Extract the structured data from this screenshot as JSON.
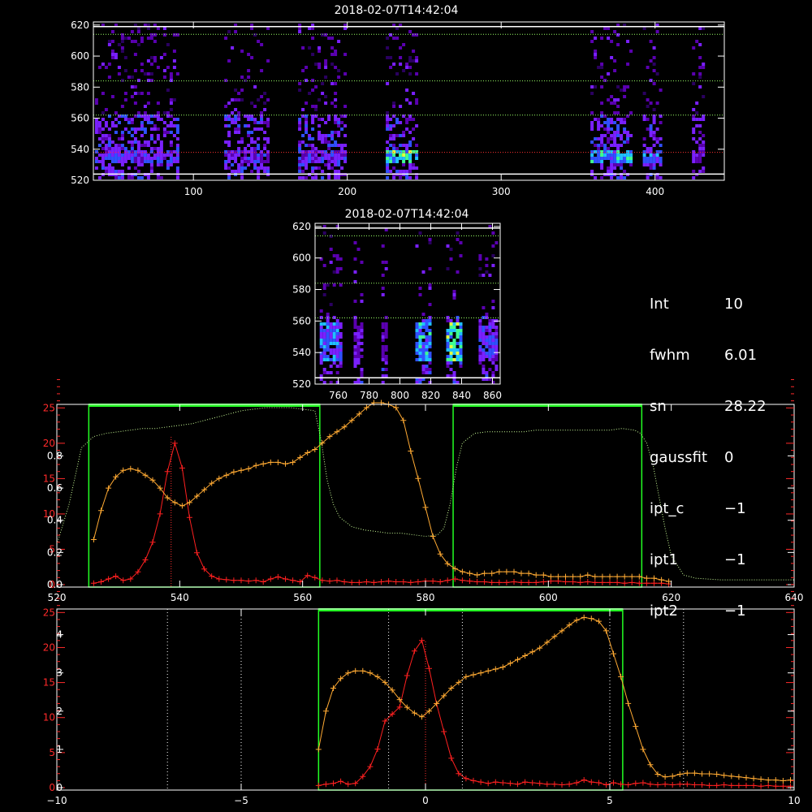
{
  "info_panel": [
    {
      "key": "Int",
      "value": "10"
    },
    {
      "key": "fwhm",
      "value": "6.01"
    },
    {
      "key": "sn",
      "value": "28.22"
    },
    {
      "key": "gaussfit",
      "value": "0"
    },
    {
      "key": "ipt_c",
      "value": "−1"
    },
    {
      "key": "ipt1",
      "value": "−1"
    },
    {
      "key": "ipt2",
      "value": "−1"
    }
  ],
  "chart_data": [
    {
      "type": "heatmap",
      "title": "2018-02-07T14:42:04",
      "xlim": [
        35,
        445
      ],
      "ylim": [
        520,
        622
      ],
      "xticks": [
        100,
        200,
        300,
        400
      ],
      "yticks": [
        520,
        540,
        560,
        580,
        600,
        620
      ],
      "colormap": [
        "#000000",
        "#2a0060",
        "#5a00b0",
        "#7a20ff",
        "#3050ff",
        "#20c0ff",
        "#40ff90",
        "#e0ff40"
      ],
      "hlines": {
        "solid_white": [
          524,
          619
        ],
        "dotted_green": [
          562,
          584,
          614
        ],
        "dotted_red": [
          538
        ]
      },
      "bands": [
        {
          "x": [
            36,
            90
          ],
          "core_intensity": 0.6
        },
        {
          "x": [
            120,
            148
          ],
          "core_intensity": 0.55
        },
        {
          "x": [
            168,
            198
          ],
          "core_intensity": 0.55
        },
        {
          "x": [
            225,
            245
          ],
          "core_intensity": 0.95
        },
        {
          "x": [
            358,
            385
          ],
          "core_intensity": 0.85
        },
        {
          "x": [
            392,
            404
          ],
          "core_intensity": 0.75
        },
        {
          "x": [
            424,
            432
          ],
          "core_intensity": 0.45
        }
      ]
    },
    {
      "type": "heatmap",
      "title": "2018-02-07T14:42:04",
      "xlim": [
        745,
        865
      ],
      "ylim": [
        520,
        622
      ],
      "xticks": [
        760,
        780,
        800,
        820,
        840,
        860
      ],
      "yticks": [
        520,
        540,
        560,
        580,
        600,
        620
      ],
      "hlines": {
        "solid_white": [
          619,
          524
        ],
        "dotted_green": [
          562,
          584,
          614
        ]
      },
      "bands": [
        {
          "x": [
            748,
            762
          ],
          "core_intensity": 0.7
        },
        {
          "x": [
            770,
            776
          ],
          "core_intensity": 0.45
        },
        {
          "x": [
            788,
            792
          ],
          "core_intensity": 0.4
        },
        {
          "x": [
            810,
            820
          ],
          "core_intensity": 0.85
        },
        {
          "x": [
            830,
            840
          ],
          "core_intensity": 1.0
        },
        {
          "x": [
            851,
            862
          ],
          "core_intensity": 0.6
        }
      ]
    },
    {
      "type": "line",
      "xlim": [
        520,
        640
      ],
      "ylim_left": [
        0,
        25.5
      ],
      "xticks": [
        520,
        540,
        560,
        580,
        600,
        620,
        640
      ],
      "yticks_red": [
        0,
        5,
        10,
        15,
        20,
        25
      ],
      "yticks_white": [
        "0.0",
        "0.2",
        "0.4",
        "0.6",
        "0.8"
      ],
      "yticks_white_values": [
        0.0,
        0.2,
        0.4,
        0.6,
        0.8
      ],
      "white_axis_max": 1.12,
      "green_boxes": [
        [
          525.2,
          562.8
        ],
        [
          584.5,
          615.2
        ]
      ],
      "red_dotted_vline": 538.6,
      "series": [
        {
          "color": "#ff2020",
          "x": [
            526,
            527.2,
            528.4,
            529.6,
            530.8,
            532,
            533.2,
            534.4,
            535.6,
            536.8,
            538,
            539.2,
            540.4,
            541.6,
            542.8,
            544,
            545.2,
            546.4,
            547.6,
            548.8,
            550,
            551.2,
            552.4,
            553.6,
            554.8,
            556,
            557.2,
            558.4,
            559.6,
            560.8,
            562,
            563.2,
            564.4,
            565.6,
            566.8,
            568,
            569.2,
            570.4,
            571.6,
            572.8,
            574,
            575.2,
            576.4,
            577.6,
            578.8,
            580,
            581.2,
            582.4,
            583.6,
            584.8,
            586,
            587.2,
            588.4,
            589.6,
            590.8,
            592,
            593.2,
            594.4,
            595.6,
            596.8,
            598,
            599.2,
            600.4,
            601.6,
            602.8,
            604,
            605.2,
            606.4,
            607.6,
            608.8,
            610,
            611.2,
            612.4,
            613.6,
            614.8,
            616,
            617.2,
            618.4,
            619.6
          ],
          "y": [
            0.2,
            0.4,
            0.8,
            1.2,
            0.6,
            0.8,
            1.8,
            3.5,
            6.0,
            10.0,
            16.0,
            20.0,
            16.5,
            9.5,
            4.5,
            2.2,
            1.2,
            0.8,
            0.7,
            0.6,
            0.6,
            0.5,
            0.6,
            0.4,
            0.8,
            1.1,
            0.8,
            0.6,
            0.4,
            1.3,
            1.0,
            0.6,
            0.5,
            0.6,
            0.4,
            0.3,
            0.3,
            0.4,
            0.3,
            0.4,
            0.5,
            0.4,
            0.4,
            0.3,
            0.4,
            0.5,
            0.5,
            0.4,
            0.6,
            0.8,
            0.6,
            0.5,
            0.4,
            0.4,
            0.3,
            0.3,
            0.3,
            0.4,
            0.3,
            0.3,
            0.3,
            0.4,
            0.5,
            0.5,
            0.4,
            0.4,
            0.3,
            0.4,
            0.3,
            0.3,
            0.3,
            0.3,
            0.2,
            0.3,
            0.2,
            0.2,
            0.2,
            0.2,
            0.1
          ]
        },
        {
          "color": "#ffaa33",
          "x": [
            526,
            527.2,
            528.4,
            529.6,
            530.8,
            532,
            533.2,
            534.4,
            535.6,
            536.8,
            538,
            539.2,
            540.4,
            541.6,
            542.8,
            544,
            545.2,
            546.4,
            547.6,
            548.8,
            550,
            551.2,
            552.4,
            553.6,
            554.8,
            556,
            557.2,
            558.4,
            559.6,
            560.8,
            562,
            563.2,
            564.4,
            565.6,
            566.8,
            568,
            569.2,
            570.4,
            571.6,
            572.8,
            574,
            575.2,
            576.4,
            577.6,
            578.8,
            580,
            581.2,
            582.4,
            583.6,
            584.8,
            586,
            587.2,
            588.4,
            589.6,
            590.8,
            592,
            593.2,
            594.4,
            595.6,
            596.8,
            598,
            599.2,
            600.4,
            601.6,
            602.8,
            604,
            605.2,
            606.4,
            607.6,
            608.8,
            610,
            611.2,
            612.4,
            613.6,
            614.8,
            616,
            617.2,
            618.4,
            619.6
          ],
          "y": [
            0.28,
            0.46,
            0.6,
            0.67,
            0.71,
            0.72,
            0.71,
            0.68,
            0.65,
            0.6,
            0.54,
            0.51,
            0.49,
            0.51,
            0.55,
            0.59,
            0.63,
            0.66,
            0.68,
            0.7,
            0.71,
            0.72,
            0.74,
            0.75,
            0.76,
            0.76,
            0.75,
            0.76,
            0.79,
            0.82,
            0.84,
            0.88,
            0.92,
            0.95,
            0.98,
            1.02,
            1.06,
            1.1,
            1.13,
            1.13,
            1.12,
            1.1,
            1.02,
            0.83,
            0.66,
            0.48,
            0.3,
            0.19,
            0.13,
            0.1,
            0.08,
            0.07,
            0.06,
            0.07,
            0.07,
            0.08,
            0.08,
            0.08,
            0.07,
            0.07,
            0.06,
            0.06,
            0.05,
            0.05,
            0.05,
            0.05,
            0.05,
            0.06,
            0.05,
            0.05,
            0.05,
            0.05,
            0.05,
            0.05,
            0.05,
            0.04,
            0.04,
            0.03,
            0.02
          ],
          "white_scale": true
        },
        {
          "color": "#ccff99",
          "dotted": true,
          "white_scale": true,
          "x": [
            520,
            522,
            524,
            526,
            528,
            530,
            532,
            534,
            536,
            538,
            540,
            542,
            544,
            546,
            548,
            550,
            552,
            554,
            556,
            558,
            560,
            562,
            563,
            564,
            565,
            566,
            568,
            570,
            572,
            574,
            576,
            578,
            580,
            582,
            583,
            584,
            585,
            586,
            588,
            590,
            592,
            594,
            596,
            598,
            600,
            602,
            604,
            606,
            608,
            610,
            612,
            614,
            615,
            616,
            617,
            618,
            619,
            620,
            622,
            624,
            628,
            632,
            636,
            640
          ],
          "y": [
            0.25,
            0.5,
            0.85,
            0.92,
            0.94,
            0.95,
            0.96,
            0.97,
            0.97,
            0.98,
            0.99,
            1.0,
            1.02,
            1.04,
            1.06,
            1.08,
            1.09,
            1.1,
            1.1,
            1.1,
            1.09,
            1.08,
            0.9,
            0.65,
            0.5,
            0.42,
            0.36,
            0.34,
            0.33,
            0.32,
            0.32,
            0.31,
            0.3,
            0.31,
            0.35,
            0.5,
            0.72,
            0.88,
            0.94,
            0.95,
            0.95,
            0.95,
            0.95,
            0.96,
            0.96,
            0.96,
            0.96,
            0.96,
            0.96,
            0.96,
            0.97,
            0.96,
            0.94,
            0.88,
            0.75,
            0.55,
            0.35,
            0.18,
            0.06,
            0.04,
            0.03,
            0.03,
            0.03,
            0.03
          ]
        }
      ]
    },
    {
      "type": "line",
      "xlim": [
        -10,
        10
      ],
      "ylim_left": [
        0,
        25.5
      ],
      "xticks": [
        -10,
        -5,
        0,
        5,
        10
      ],
      "yticks_red": [
        0,
        5,
        10,
        15,
        20,
        25
      ],
      "yticks_white": [
        "0",
        "1",
        "2",
        "3",
        "4"
      ],
      "yticks_white_values": [
        0,
        1,
        2,
        3,
        4
      ],
      "white_axis_max": 4.67,
      "green_box": [
        -2.9,
        5.35
      ],
      "dotted_vlines": [
        -7,
        -5,
        -1,
        1,
        5,
        7
      ],
      "red_dotted_vline": 0,
      "series": [
        {
          "color": "#ff2020",
          "x": [
            -2.9,
            -2.7,
            -2.5,
            -2.3,
            -2.1,
            -1.9,
            -1.7,
            -1.5,
            -1.3,
            -1.1,
            -0.9,
            -0.7,
            -0.5,
            -0.3,
            -0.1,
            0.1,
            0.3,
            0.5,
            0.7,
            0.9,
            1.1,
            1.3,
            1.5,
            1.7,
            1.9,
            2.1,
            2.3,
            2.5,
            2.7,
            2.9,
            3.1,
            3.3,
            3.5,
            3.7,
            3.9,
            4.1,
            4.3,
            4.5,
            4.7,
            4.9,
            5.1,
            5.3,
            5.5,
            5.7,
            5.9,
            6.1,
            6.3,
            6.5,
            6.7,
            6.9,
            7.1,
            7.3,
            7.5,
            7.7,
            7.9,
            8.1,
            8.3,
            8.5,
            8.7,
            8.9,
            9.1,
            9.3,
            9.5,
            9.7,
            9.9
          ],
          "y": [
            0.3,
            0.5,
            0.6,
            0.9,
            0.5,
            0.6,
            1.6,
            3.0,
            5.5,
            9.5,
            10.5,
            11.5,
            16.0,
            19.5,
            21.0,
            17.0,
            12.0,
            8.0,
            4.2,
            2.0,
            1.3,
            1.0,
            0.8,
            0.6,
            0.8,
            0.7,
            0.6,
            0.5,
            0.8,
            0.7,
            0.6,
            0.5,
            0.5,
            0.4,
            0.5,
            0.7,
            1.1,
            0.8,
            0.7,
            0.4,
            0.7,
            0.5,
            0.4,
            0.6,
            0.7,
            0.5,
            0.4,
            0.5,
            0.4,
            0.5,
            0.5,
            0.4,
            0.4,
            0.3,
            0.3,
            0.4,
            0.3,
            0.3,
            0.3,
            0.3,
            0.2,
            0.3,
            0.2,
            0.2,
            0.2
          ]
        },
        {
          "color": "#ffaa33",
          "white_scale": true,
          "x": [
            -2.9,
            -2.7,
            -2.5,
            -2.3,
            -2.1,
            -1.9,
            -1.7,
            -1.5,
            -1.3,
            -1.1,
            -0.9,
            -0.7,
            -0.5,
            -0.3,
            -0.1,
            0.1,
            0.3,
            0.5,
            0.7,
            0.9,
            1.1,
            1.3,
            1.5,
            1.7,
            1.9,
            2.1,
            2.3,
            2.5,
            2.7,
            2.9,
            3.1,
            3.3,
            3.5,
            3.7,
            3.9,
            4.1,
            4.3,
            4.5,
            4.7,
            4.9,
            5.1,
            5.3,
            5.5,
            5.7,
            5.9,
            6.1,
            6.3,
            6.5,
            6.7,
            6.9,
            7.1,
            7.3,
            7.5,
            7.7,
            7.9,
            8.1,
            8.3,
            8.5,
            8.7,
            8.9,
            9.1,
            9.3,
            9.5,
            9.7,
            9.9
          ],
          "y": [
            1.0,
            2.0,
            2.6,
            2.85,
            3.0,
            3.05,
            3.05,
            3.0,
            2.9,
            2.75,
            2.55,
            2.3,
            2.1,
            1.95,
            1.85,
            2.0,
            2.2,
            2.4,
            2.6,
            2.75,
            2.9,
            2.95,
            3.0,
            3.05,
            3.1,
            3.15,
            3.25,
            3.35,
            3.45,
            3.55,
            3.65,
            3.8,
            3.95,
            4.1,
            4.25,
            4.38,
            4.45,
            4.42,
            4.35,
            4.1,
            3.5,
            2.9,
            2.2,
            1.6,
            1.0,
            0.6,
            0.35,
            0.28,
            0.3,
            0.35,
            0.38,
            0.38,
            0.36,
            0.36,
            0.35,
            0.32,
            0.3,
            0.28,
            0.26,
            0.24,
            0.22,
            0.2,
            0.2,
            0.18,
            0.2
          ]
        }
      ]
    }
  ]
}
